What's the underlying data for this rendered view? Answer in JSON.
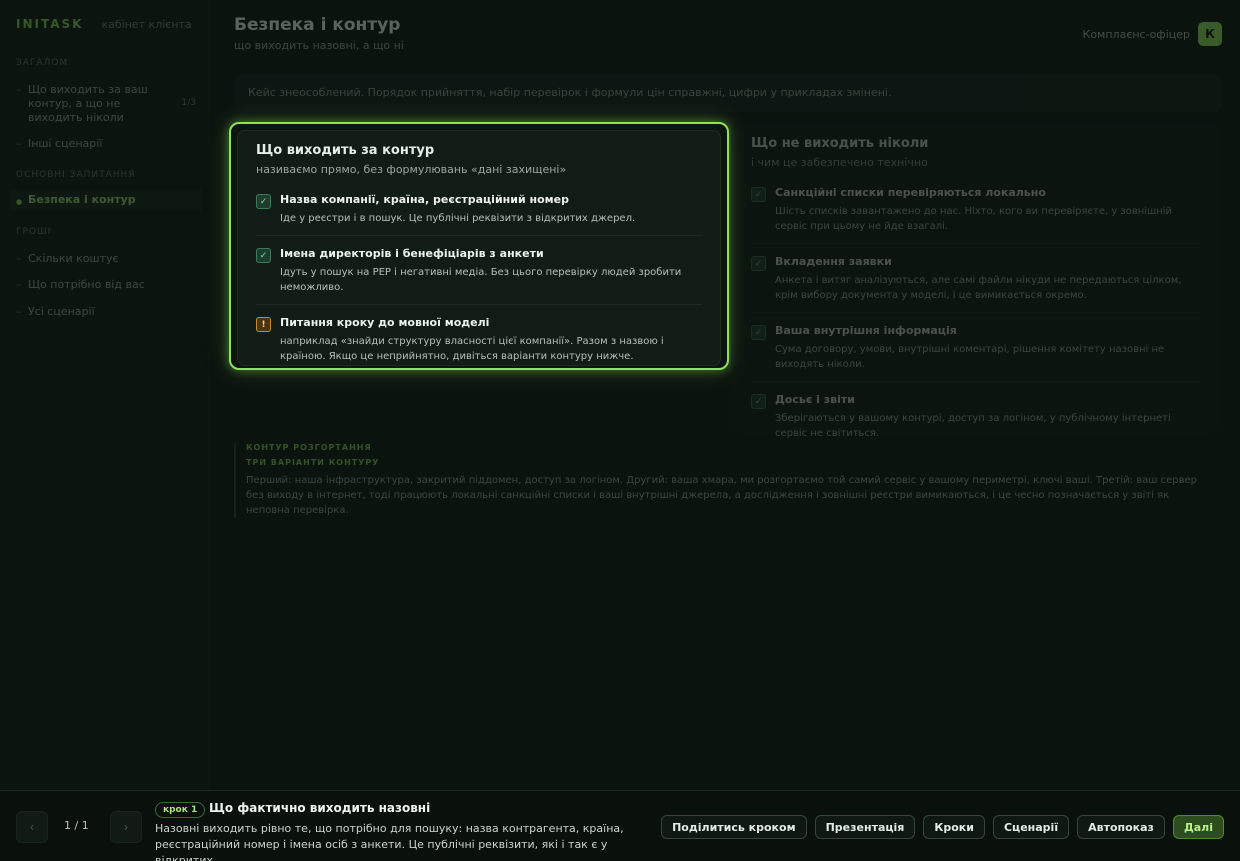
{
  "sidebar": {
    "brand": "INITASK",
    "brand_sub": "кабінет клієнта",
    "sections": [
      {
        "label": "ЗАГАЛОМ"
      },
      {
        "label": "ОСНОВНІ ЗАПИТАННЯ"
      },
      {
        "label": "ГРОШІ"
      }
    ],
    "items": [
      {
        "label": "Що виходить за ваш контур, а що не виходить ніколи",
        "badge": "1/3"
      },
      {
        "label": "Інші сценарії"
      },
      {
        "label": "Безпека і контур"
      },
      {
        "label": "Скільки коштує"
      },
      {
        "label": "Що потрібно від вас"
      },
      {
        "label": "Усі сценарії"
      }
    ]
  },
  "header": {
    "title": "Безпека і контур",
    "subtitle": "що виходить назовні, а що ні",
    "user_name": "Комплаєнс-офіцер",
    "avatar_initial": "К"
  },
  "notice": "Кейс знеособлений. Порядок прийняття, набір перевірок і формули цін справжні, цифри у прикладах змінені.",
  "card_left": {
    "title": "Що виходить за контур",
    "subtitle": "називаємо прямо, без формулювань «дані захищені»",
    "items": [
      {
        "icon": "check-icon",
        "mark": "✓",
        "title": "Назва компанії, країна, реєстраційний номер",
        "desc": "Іде у реєстри і в пошук. Це публічні реквізити з відкритих джерел."
      },
      {
        "icon": "check-icon",
        "mark": "✓",
        "title": "Імена директорів і бенефіціарів з анкети",
        "desc": "Ідуть у пошук на PEP і негативні медіа. Без цього перевірку людей зробити неможливо."
      },
      {
        "icon": "warning-icon",
        "mark": "!",
        "title": "Питання кроку до мовної моделі",
        "desc": "наприклад «знайди структуру власності цієї компанії». Разом з назвою і країною. Якщо це неприйнятно, дивіться варіанти контуру нижче."
      }
    ]
  },
  "card_right": {
    "title": "Що не виходить ніколи",
    "subtitle": "і чим це забезпечено технічно",
    "items": [
      {
        "title": "Санкційні списки перевіряються локально",
        "desc": "Шість списків завантажено до нас. Ніхто, кого ви перевіряєте, у зовнішній сервіс при цьому не йде взагалі."
      },
      {
        "title": "Вкладення заявки",
        "desc": "Анкета і витяг аналізуються, але самі файли нікуди не передаються цілком, крім вибору документа у моделі, і це вимикається окремо."
      },
      {
        "title": "Ваша внутрішня інформація",
        "desc": "Сума договору, умови, внутрішні коментарі, рішення комітету назовні не виходять ніколи."
      },
      {
        "title": "Досьє і звіти",
        "desc": "Зберігаються у вашому контурі, доступ за логіном, у публічному інтернеті сервіс не світиться."
      }
    ]
  },
  "deploy": {
    "kicker": "КОНТУР РОЗГОРТАННЯ",
    "title": "ТРИ ВАРІАНТИ КОНТУРУ",
    "text": "Перший: наша інфраструктура, закритий піддомен, доступ за логіном. Другий: ваша хмара, ми розгортаємо той самий сервіс у вашому периметрі, ключі ваші. Третій: ваш сервер без виходу в інтернет, тоді працюють локальні санкційні списки і ваші внутрішні джерела, а дослідження і зовнішні реєстри вимикаються, і це чесно позначається у звіті як неповна перевірка."
  },
  "bottom": {
    "prev_icon": "‹",
    "next_icon": "›",
    "counter": "1 / 1",
    "step_badge": "крок 1",
    "step_title": "Що фактично виходить назовні",
    "step_desc": "Назовні виходить рівно те, що потрібно для пошуку: назва контрагента, країна, реєстраційний номер і імена осіб з анкети. Це публічні реквізити, які і так є у відкритих...",
    "actions": {
      "share": "Поділитись кроком",
      "presentation": "Презентація",
      "steps": "Кроки",
      "scenarios": "Сценарії",
      "autoplay": "Автопоказ",
      "next": "Далі"
    }
  }
}
